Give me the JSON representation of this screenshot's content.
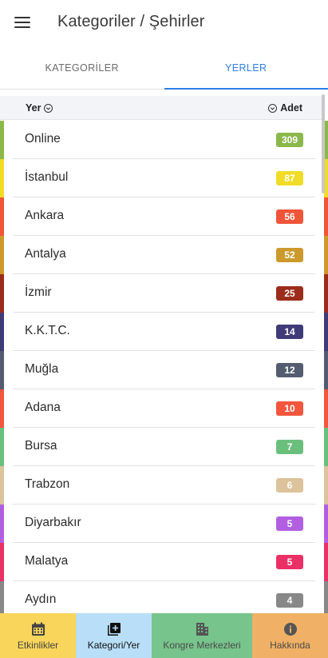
{
  "header": {
    "title": "Kategoriler / Şehirler",
    "menu_icon": "menu-icon"
  },
  "tabs": [
    {
      "label": "KATEGORİLER",
      "active": false
    },
    {
      "label": "YERLER",
      "active": true
    }
  ],
  "accent_color": "#2f7ee8",
  "list_header": {
    "left_label": "Yer",
    "right_label": "Adet",
    "sort_icon": "chevron-down-circle-icon"
  },
  "items": [
    {
      "name": "Online",
      "count": "309",
      "color": "#8bb84a"
    },
    {
      "name": "İstanbul",
      "count": "87",
      "color": "#f0dc27"
    },
    {
      "name": "Ankara",
      "count": "56",
      "color": "#ef5539"
    },
    {
      "name": "Antalya",
      "count": "52",
      "color": "#cc9a2c"
    },
    {
      "name": "İzmir",
      "count": "25",
      "color": "#9c2c1b"
    },
    {
      "name": "K.K.T.C.",
      "count": "14",
      "color": "#3f3b78"
    },
    {
      "name": "Muğla",
      "count": "12",
      "color": "#545c70"
    },
    {
      "name": "Adana",
      "count": "10",
      "color": "#f2563d"
    },
    {
      "name": "Bursa",
      "count": "7",
      "color": "#6bbf7c"
    },
    {
      "name": "Trabzon",
      "count": "6",
      "color": "#dcc39b"
    },
    {
      "name": "Diyarbakır",
      "count": "5",
      "color": "#b15fe0"
    },
    {
      "name": "Malatya",
      "count": "5",
      "color": "#ea3064"
    },
    {
      "name": "Aydın",
      "count": "4",
      "color": "#888888"
    }
  ],
  "bottom_nav": [
    {
      "label": "Etkinlikler",
      "icon": "calendar-icon",
      "bg": "#f9d55b",
      "color": "#444444",
      "active": false
    },
    {
      "label": "Kategori/Yer",
      "icon": "library-add-icon",
      "bg": "#b9dff8",
      "color": "#111111",
      "active": true
    },
    {
      "label": "Kongre Merkezleri",
      "icon": "building-icon",
      "bg": "#77c48c",
      "color": "#4a4a4a",
      "active": false
    },
    {
      "label": "Hakkında",
      "icon": "info-icon",
      "bg": "#f0b065",
      "color": "#4a4a4a",
      "active": false
    }
  ]
}
